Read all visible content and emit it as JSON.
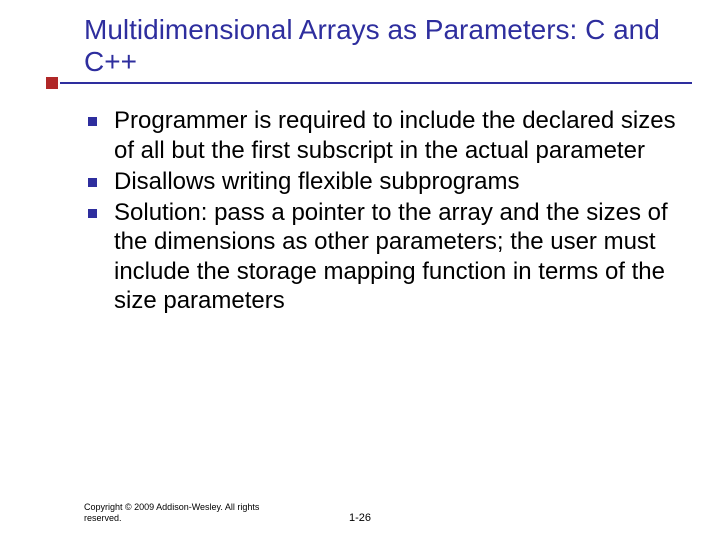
{
  "slide": {
    "title": "Multidimensional Arrays as Parameters: C and C++",
    "bullets": [
      "Programmer is required to include the declared sizes of all but the first subscript in the actual parameter",
      "Disallows writing flexible subprograms",
      "Solution: pass a pointer to the array and the sizes of the dimensions as other parameters; the user must include the storage mapping function in terms of the size parameters"
    ],
    "footer": {
      "copyright": "Copyright © 2009 Addison-Wesley. All rights reserved.",
      "page": "1-26"
    }
  }
}
